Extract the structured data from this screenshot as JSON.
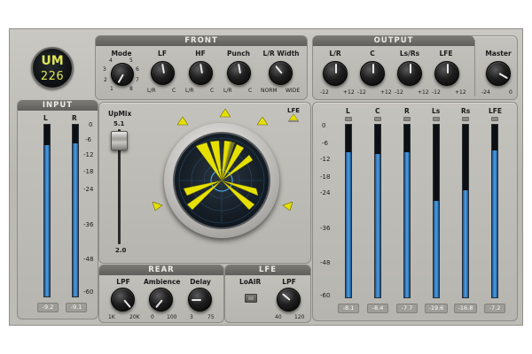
{
  "logo": {
    "line1": "UM",
    "line2": "226"
  },
  "front": {
    "title": "FRONT",
    "knobs": [
      {
        "label": "Mode",
        "min": "1",
        "max": "8",
        "value_angle_note": "mode knob",
        "extra": [
          "2",
          "3",
          "4",
          "5",
          "6",
          "7"
        ]
      },
      {
        "label": "LF",
        "min": "L/R",
        "max": "C"
      },
      {
        "label": "HF",
        "min": "L/R",
        "max": "C"
      },
      {
        "label": "Punch",
        "min": "L/R",
        "max": "C"
      },
      {
        "label": "L/R Width",
        "min": "NORM",
        "max": "WIDE"
      }
    ]
  },
  "output": {
    "title": "OUTPUT",
    "knobs": [
      {
        "label": "L/R",
        "min": "-12",
        "max": "+12"
      },
      {
        "label": "C",
        "min": "-12",
        "max": "+12"
      },
      {
        "label": "Ls/Rs",
        "min": "-12",
        "max": "+12"
      },
      {
        "label": "LFE",
        "min": "-12",
        "max": "+12"
      }
    ],
    "master": {
      "label": "Master",
      "min": "-24",
      "max": "0"
    }
  },
  "input": {
    "title": "INPUT",
    "channels": [
      {
        "label": "L",
        "readout": "-9.2",
        "level": 0.88
      },
      {
        "label": "R",
        "readout": "-9.1",
        "level": 0.89
      }
    ],
    "scale": [
      "0",
      "-6",
      "-12",
      "-18",
      "-24",
      "-36",
      "-48",
      "-60"
    ]
  },
  "upmix": {
    "label": "UpMix",
    "top": "5.1",
    "bottom": "2.0",
    "lfe_label": "LFE"
  },
  "output_meters": {
    "scale": [
      "0",
      "-6",
      "-12",
      "-18",
      "-24",
      "-36",
      "-48",
      "-60"
    ],
    "channels": [
      {
        "label": "L",
        "readout": "-8.1",
        "level": 0.84
      },
      {
        "label": "C",
        "readout": "-8.4",
        "level": 0.83
      },
      {
        "label": "R",
        "readout": "-7.7",
        "level": 0.84
      },
      {
        "label": "Ls",
        "readout": "-19.6",
        "level": 0.56
      },
      {
        "label": "Rs",
        "readout": "-16.8",
        "level": 0.62
      },
      {
        "label": "LFE",
        "readout": "-7.2",
        "level": 0.85
      }
    ]
  },
  "rear": {
    "title": "REAR",
    "knobs": [
      {
        "label": "LPF",
        "min": "1K",
        "max": "20K"
      },
      {
        "label": "Ambience",
        "min": "0",
        "max": "100"
      },
      {
        "label": "Delay",
        "min": "3",
        "max": "75"
      }
    ]
  },
  "lfe": {
    "title": "LFE",
    "loair_label": "LoAIR",
    "lpf": {
      "label": "LPF",
      "min": "40",
      "max": "120"
    }
  },
  "colors": {
    "accent_yellow": "#e5e000",
    "meter_blue": "#4fa3e6",
    "logo_text": "#dfe65a"
  }
}
